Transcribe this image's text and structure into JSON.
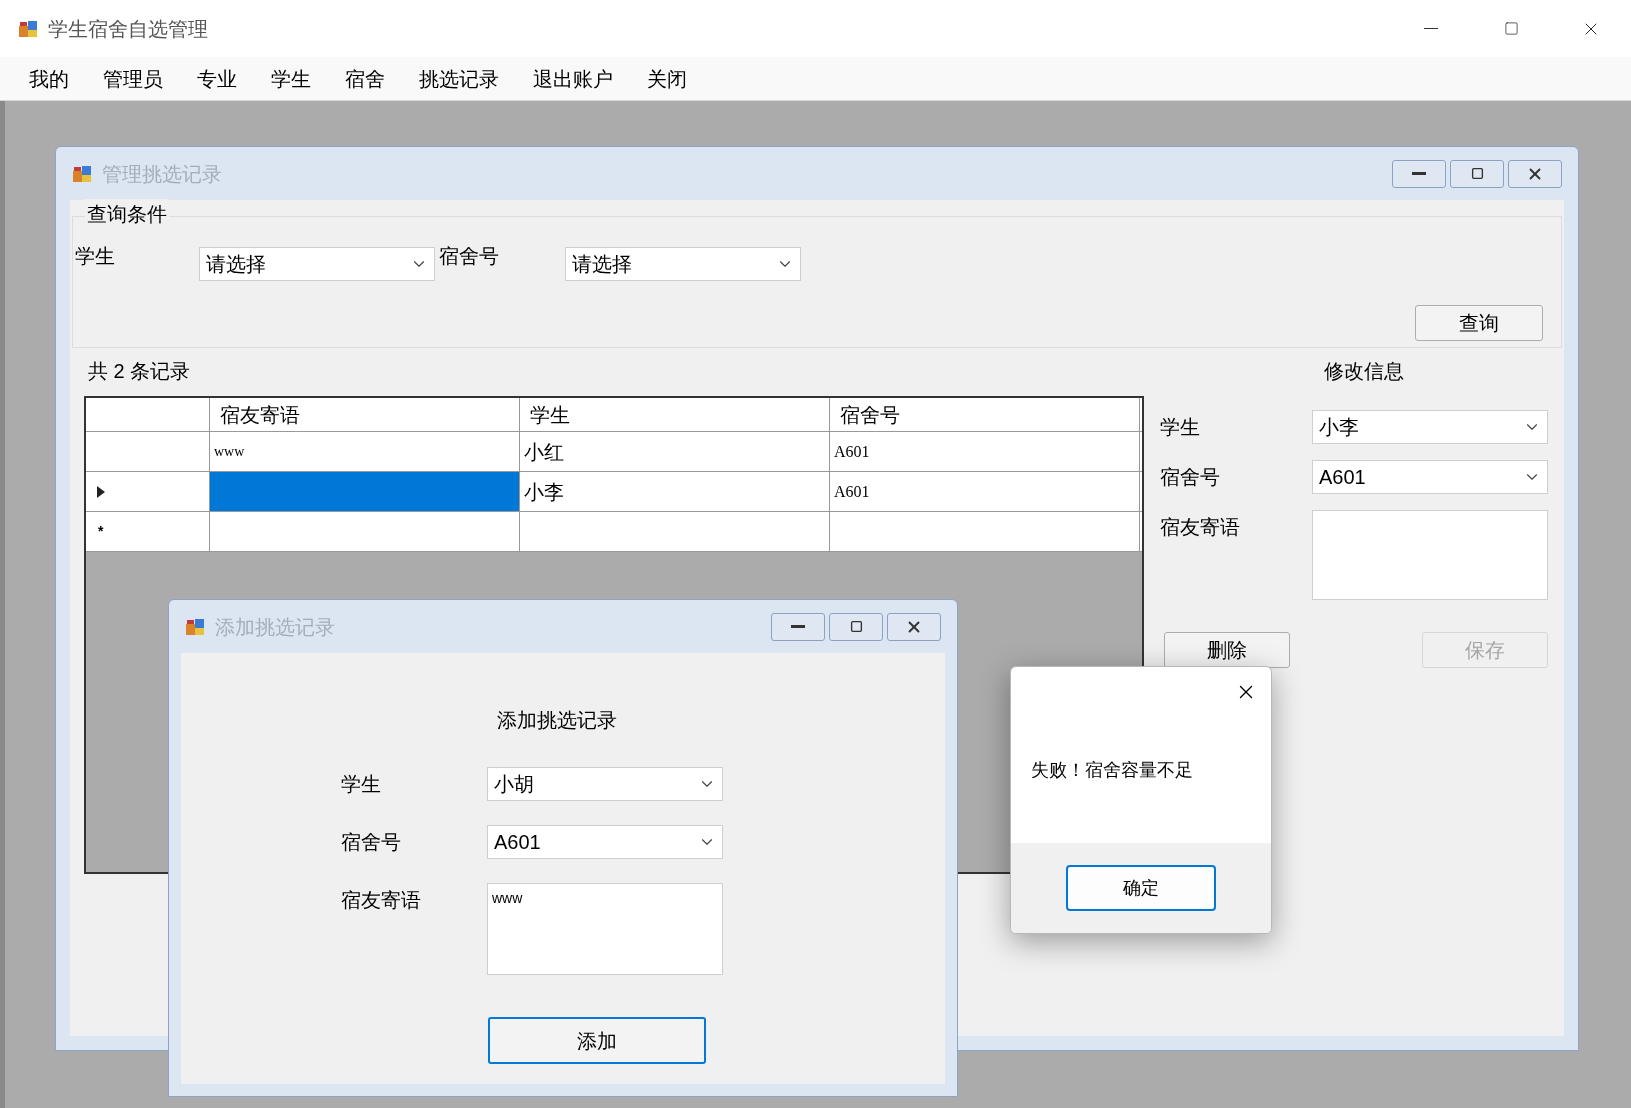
{
  "window": {
    "title": "学生宿舍自选管理"
  },
  "menu": [
    {
      "label": "我的"
    },
    {
      "label": "管理员"
    },
    {
      "label": "专业"
    },
    {
      "label": "学生"
    },
    {
      "label": "宿舍"
    },
    {
      "label": "挑选记录"
    },
    {
      "label": "退出账户"
    },
    {
      "label": "关闭"
    }
  ],
  "manage_window": {
    "title": "管理挑选记录",
    "query": {
      "title": "查询条件",
      "fields": [
        {
          "label": "学生",
          "value": "请选择"
        },
        {
          "label": "宿舍号",
          "value": "请选择"
        }
      ],
      "button": "查询"
    },
    "count": "共 2 条记录",
    "grid": {
      "columns": [
        "宿友寄语",
        "学生",
        "宿舍号"
      ],
      "rows": [
        {
          "selected": false,
          "cells": [
            "www",
            "小红",
            "A601"
          ]
        },
        {
          "selected": true,
          "cells": [
            null,
            "小李",
            "A601"
          ]
        }
      ],
      "new_row_marker": "*"
    },
    "edit": {
      "title": "修改信息",
      "fields": [
        {
          "kind": "combo",
          "label": "学生",
          "value": "小李"
        },
        {
          "kind": "combo",
          "label": "宿舍号",
          "value": "A601"
        },
        {
          "kind": "text",
          "label": "宿友寄语"
        }
      ],
      "buttons": [
        {
          "label": "删除",
          "disabled": false
        },
        {
          "label": "保存",
          "disabled": true
        }
      ]
    }
  },
  "add_window": {
    "title": "添加挑选记录",
    "heading": "添加挑选记录",
    "fields": [
      {
        "kind": "combo",
        "label": "学生",
        "value": "小胡"
      },
      {
        "kind": "combo",
        "label": "宿舍号",
        "value": "A601"
      },
      {
        "kind": "text",
        "label": "宿友寄语",
        "value": "www"
      }
    ],
    "button": "添加"
  },
  "message_box": {
    "text": "失败！宿舍容量不足",
    "button": "确定"
  }
}
